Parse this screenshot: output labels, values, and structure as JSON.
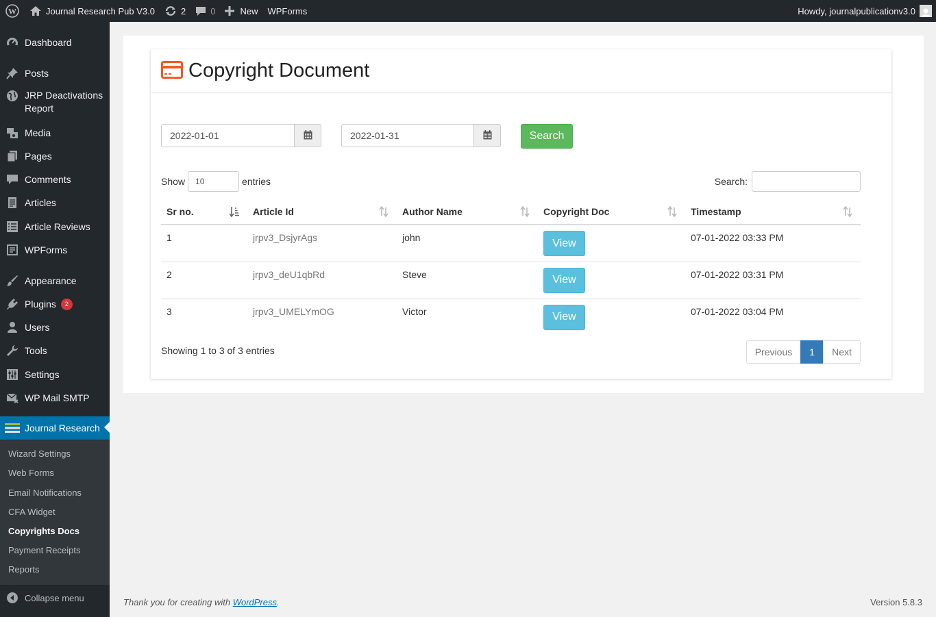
{
  "adminbar": {
    "site_name": "Journal Research Pub V3.0",
    "updates_count": "2",
    "comments_count": "0",
    "new_label": "New",
    "wpforms_label": "WPForms",
    "howdy": "Howdy, journalpublicationv3.0"
  },
  "sidebar": {
    "items": [
      {
        "label": "Dashboard",
        "icon": "dashboard-icon"
      },
      {
        "label": "Posts",
        "icon": "pin-icon"
      },
      {
        "label": "JRP Deactivations Report",
        "icon": "globe-icon"
      },
      {
        "label": "Media",
        "icon": "media-icon"
      },
      {
        "label": "Pages",
        "icon": "pages-icon"
      },
      {
        "label": "Comments",
        "icon": "comment-icon"
      },
      {
        "label": "Articles",
        "icon": "article-icon"
      },
      {
        "label": "Article Reviews",
        "icon": "list-icon"
      },
      {
        "label": "WPForms",
        "icon": "forms-icon"
      },
      {
        "label": "Appearance",
        "icon": "brush-icon"
      },
      {
        "label": "Plugins",
        "icon": "plugin-icon",
        "badge": "2"
      },
      {
        "label": "Users",
        "icon": "user-icon"
      },
      {
        "label": "Tools",
        "icon": "wrench-icon"
      },
      {
        "label": "Settings",
        "icon": "settings-icon"
      },
      {
        "label": "WP Mail SMTP",
        "icon": "mail-icon"
      },
      {
        "label": "Journal Research",
        "icon": "journal-icon"
      }
    ],
    "submenu": [
      "Wizard Settings",
      "Web Forms",
      "Email Notifications",
      "CFA Widget",
      "Copyrights Docs",
      "Payment Receipts",
      "Reports"
    ],
    "collapse_label": "Collapse menu"
  },
  "page": {
    "title": "Copyright Document",
    "from_date": "2022-01-01",
    "to_date": "2022-01-31",
    "search_button": "Search",
    "show_label": "Show",
    "entries_value": "10",
    "entries_label": "entries",
    "search_label": "Search:",
    "columns": [
      "Sr no.",
      "Article Id",
      "Author Name",
      "Copyright Doc",
      "Timestamp"
    ],
    "rows": [
      {
        "sr": "1",
        "article_id": "jrpv3_DsjyrAgs",
        "author": "john",
        "doc": "View",
        "timestamp": "07-01-2022 03:33 PM"
      },
      {
        "sr": "2",
        "article_id": "jrpv3_deU1qbRd",
        "author": "Steve",
        "doc": "View",
        "timestamp": "07-01-2022 03:31 PM"
      },
      {
        "sr": "3",
        "article_id": "jrpv3_UMELYmOG",
        "author": "Victor",
        "doc": "View",
        "timestamp": "07-01-2022 03:04 PM"
      }
    ],
    "info": "Showing 1 to 3 of 3 entries",
    "pagination": {
      "previous": "Previous",
      "current": "1",
      "next": "Next"
    }
  },
  "footer": {
    "thanks_prefix": "Thank you for creating with ",
    "thanks_link": "WordPress",
    "thanks_suffix": ".",
    "version": "Version 5.8.3"
  },
  "colors": {
    "admin_dark": "#23282d",
    "active_blue": "#0073aa",
    "search_green": "#5cb85c",
    "view_blue": "#5bc0de",
    "pager_blue": "#337ab7",
    "title_icon": "#f05a28"
  }
}
